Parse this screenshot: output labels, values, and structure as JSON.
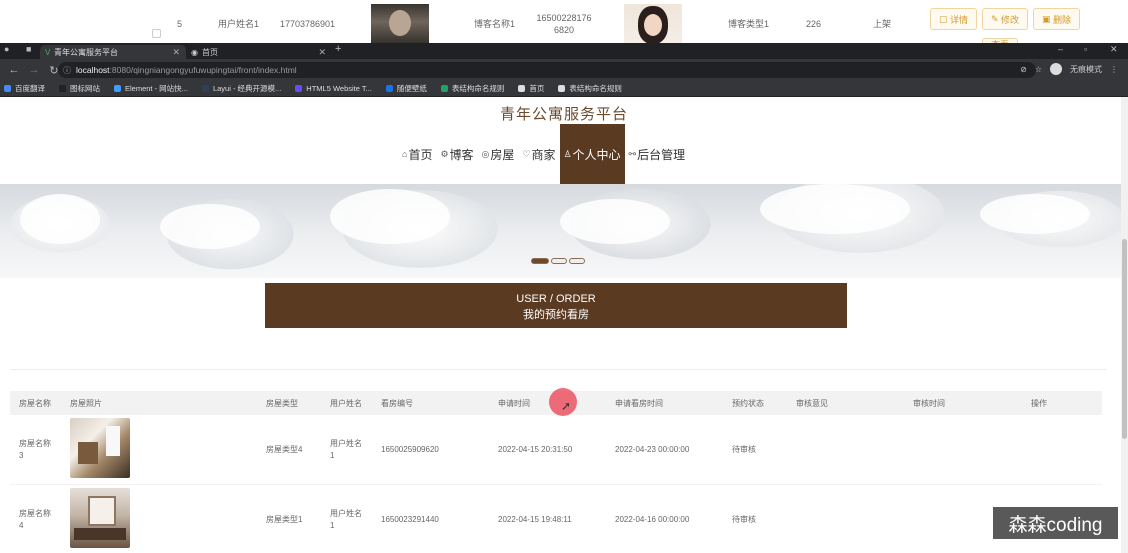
{
  "background_admin": {
    "row": {
      "index": "5",
      "username": "用户姓名1",
      "phone": "17703786901",
      "blogger_name": "博客名称1",
      "id_number": "16500228176 6820",
      "blogger_type": "博客类型1",
      "count": "226",
      "status": "上架"
    },
    "buttons": [
      "详情",
      "修改",
      "删除"
    ],
    "extra_button": "查看"
  },
  "browser": {
    "tabs": [
      {
        "label": "青年公寓服务平台"
      },
      {
        "label": "首页"
      }
    ],
    "new_tab": "+",
    "url": {
      "host": "localhost",
      "path": ":8080/qingniangongyufuwupingtai/front/index.html"
    },
    "incognito_label": "无痕模式",
    "bookmarks": [
      {
        "label": "百度翻译",
        "color": "#4a8af4"
      },
      {
        "label": "图标网站",
        "color": "#222222"
      },
      {
        "label": "Element - 网站快...",
        "color": "#409eff"
      },
      {
        "label": "Layui - 经典开源模...",
        "color": "#2f4056"
      },
      {
        "label": "HTML5 Website T...",
        "color": "#6a4cff"
      },
      {
        "label": "随便壁纸",
        "color": "#1a73e8"
      },
      {
        "label": "表结构命名规则",
        "color": "#21a366"
      },
      {
        "label": "首页",
        "color": "#dddddd"
      },
      {
        "label": "表结构命名规则",
        "color": "#dddddd"
      }
    ]
  },
  "site": {
    "title": "青年公寓服务平台",
    "nav": [
      {
        "label": "首页",
        "icon": "home-icon",
        "glyph": "⌂",
        "active": false
      },
      {
        "label": "博客",
        "icon": "blog-icon",
        "glyph": "⚙",
        "active": false
      },
      {
        "label": "房屋",
        "icon": "house-icon",
        "glyph": "◎",
        "active": false
      },
      {
        "label": "商家",
        "icon": "shop-icon",
        "glyph": "♡",
        "active": false
      },
      {
        "label": "个人中心",
        "icon": "user-icon",
        "glyph": "♙",
        "active": true
      },
      {
        "label": "后台管理",
        "icon": "link-icon",
        "glyph": "⚯",
        "active": false
      }
    ],
    "accent_color": "#5b3a22"
  },
  "section": {
    "en_title": "USER / ORDER",
    "cn_title": "我的预约看房"
  },
  "table": {
    "columns": [
      "房屋名称",
      "房屋照片",
      "房屋类型",
      "用户姓名",
      "看房编号",
      "申请时间",
      "申请看房时间",
      "预约状态",
      "审核意见",
      "审核时间",
      "操作"
    ],
    "rows": [
      {
        "house_name": "房屋名称3",
        "house_type": "房屋类型4",
        "username": "用户姓名1",
        "order_no": "1650025909620",
        "apply_time": "2022-04-15 20:31:50",
        "visit_time": "2022-04-23 00:00:00",
        "status": "待审核",
        "review": "",
        "review_time": "",
        "photo": "living-room-photo"
      },
      {
        "house_name": "房屋名称4",
        "house_type": "房屋类型1",
        "username": "用户姓名1",
        "order_no": "1650023291440",
        "apply_time": "2022-04-15 19:48:11",
        "visit_time": "2022-04-16 00:00:00",
        "status": "待审核",
        "review": "",
        "review_time": "",
        "photo": "bedroom-photo"
      }
    ]
  },
  "watermark": "森森coding"
}
